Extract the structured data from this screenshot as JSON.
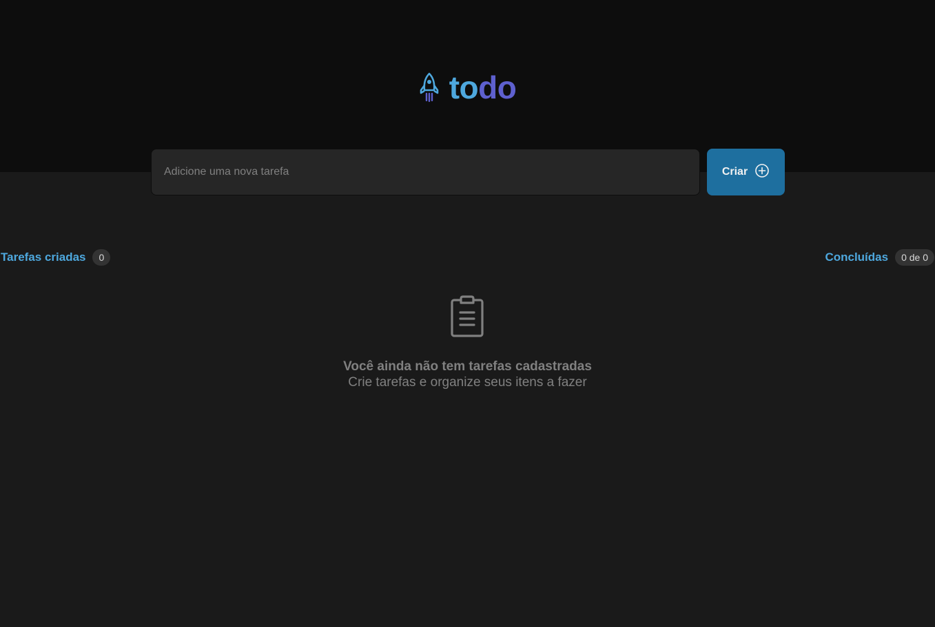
{
  "app": {
    "logo_part1": "to",
    "logo_part2": "do",
    "logo_icon": "rocket-icon"
  },
  "new_task": {
    "placeholder": "Adicione uma nova tarefa",
    "value": "",
    "create_label": "Criar",
    "create_icon": "plus-circle-icon"
  },
  "stats": {
    "created_label": "Tarefas criadas",
    "created_count": "0",
    "done_label": "Concluídas",
    "done_count": "0 de 0"
  },
  "empty_state": {
    "icon": "clipboard-icon",
    "title": "Você ainda não tem tarefas cadastradas",
    "subtitle": "Crie tarefas e organize seus itens a fazer"
  },
  "colors": {
    "header_bg": "#0d0d0d",
    "body_bg": "#1a1a1a",
    "blue": "#4ea8de",
    "purple": "#5e60ce",
    "button": "#1e6f9f"
  }
}
